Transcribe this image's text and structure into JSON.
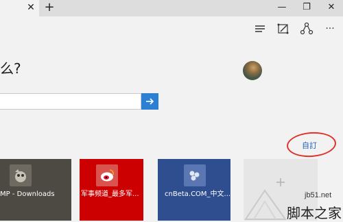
{
  "browser": {
    "tab_close_glyph": "✕",
    "new_tab_glyph": "+",
    "window_controls": [
      "—",
      "❐",
      "✕"
    ]
  },
  "toolbar": {
    "icons": [
      "hub-icon",
      "web-note-icon",
      "share-icon",
      "more-icon"
    ],
    "more_glyph": "···"
  },
  "page": {
    "greeting": "么?",
    "search": {
      "placeholder": ""
    },
    "search_go_glyph": "→",
    "customize_label": "自訂",
    "tiles": [
      {
        "label": "MP - Downloads",
        "bg": "#4d4a44",
        "icon": "gimp-icon"
      },
      {
        "label": "军事频道_最多军...",
        "bg": "#cc0000",
        "icon": "weibo-icon"
      },
      {
        "label": "cnBeta.COM_中文...",
        "bg": "#2f4e8f",
        "icon": "cnbeta-icon"
      },
      {
        "label": "",
        "bg": "#e6e6e6",
        "icon": "add-tile-icon"
      }
    ]
  },
  "watermark": {
    "url": "jb51.net",
    "brand": "脚本之家"
  },
  "colors": {
    "accent": "#2d7fd3",
    "annotation": "#e0322b",
    "link": "#1a5fb4"
  }
}
